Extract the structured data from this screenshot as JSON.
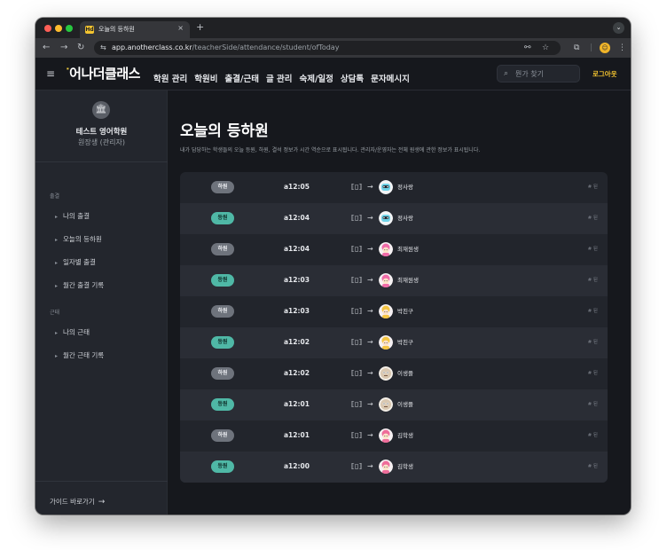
{
  "browser": {
    "tab_title": "오늘의 등하원",
    "favicon_text": "Hd",
    "tab_close": "×",
    "new_tab": "+",
    "tab_menu": "⌄",
    "back": "←",
    "forward": "→",
    "reload": "↻",
    "site_icon": "⇆",
    "url_host": "app.anotherclass.co.kr",
    "url_path": "/teacherSide/attendance/student/ofToday",
    "icons": [
      "link-icon",
      "star-icon",
      "extensions-icon",
      "profile-icon",
      "menu-icon"
    ]
  },
  "header": {
    "hamburger": "≡",
    "logo_spark": "ᴗ̀",
    "logo_text": "어나더클래스",
    "menu": [
      "학원 관리",
      "학원비",
      "출결/근태",
      "글 관리",
      "숙제/일정",
      "상담톡",
      "문자메시지"
    ],
    "search_placeholder": "뭔가 찾기",
    "logout": "로그아웃"
  },
  "sidebar": {
    "school_name": "테스트 영어학원",
    "school_role": "원장생 (관리자)",
    "sections": [
      {
        "title": "출결",
        "items": [
          "나의 출결",
          "오늘의 등하원",
          "일자별 출결",
          "월간 출결 기록"
        ]
      },
      {
        "title": "근태",
        "items": [
          "나의 근태",
          "월간 근태 기록"
        ]
      }
    ],
    "guide": "가이드 바로가기"
  },
  "main": {
    "title": "오늘의 등하원",
    "description": "내가 담당하는 학생들의 오늘 등원, 하원, 결석 정보가 시간 역순으로 표시됩니다. 관리자/운영자는 전체 원생에 관한 정보가 표시됩니다.",
    "arrow": "→",
    "device_icon": "⟦▯⟧",
    "rows": [
      {
        "status": "하원",
        "kind": "out",
        "time": "a12:05",
        "student": "정사랑",
        "avatar": "robot",
        "tag": "# 된"
      },
      {
        "status": "등원",
        "kind": "in",
        "time": "a12:04",
        "student": "정사랑",
        "avatar": "robot",
        "tag": "# 된"
      },
      {
        "status": "하원",
        "kind": "out",
        "time": "a12:04",
        "student": "최재원생",
        "avatar": "pink",
        "tag": "# 된"
      },
      {
        "status": "등원",
        "kind": "in",
        "time": "a12:03",
        "student": "최재원생",
        "avatar": "pink",
        "tag": "# 된"
      },
      {
        "status": "하원",
        "kind": "out",
        "time": "a12:03",
        "student": "박친구",
        "avatar": "yellow",
        "tag": "# 된"
      },
      {
        "status": "등원",
        "kind": "in",
        "time": "a12:02",
        "student": "박친구",
        "avatar": "yellow",
        "tag": "# 된"
      },
      {
        "status": "하원",
        "kind": "out",
        "time": "a12:02",
        "student": "이생플",
        "avatar": "beige",
        "tag": "# 된"
      },
      {
        "status": "등원",
        "kind": "in",
        "time": "a12:01",
        "student": "이생플",
        "avatar": "beige",
        "tag": "# 된"
      },
      {
        "status": "하원",
        "kind": "out",
        "time": "a12:01",
        "student": "김학생",
        "avatar": "rose",
        "tag": "# 된"
      },
      {
        "status": "등원",
        "kind": "in",
        "time": "a12:00",
        "student": "김학생",
        "avatar": "rose",
        "tag": "# 된"
      }
    ]
  },
  "colors": {
    "accent": "#f4c430",
    "badge_in": "#4fb8a6",
    "badge_out": "#6e737c",
    "avatar_robot": "#6fd3e8",
    "avatar_pink": "#f06ba8",
    "avatar_yellow": "#f5c542",
    "avatar_beige": "#d9c7b0",
    "avatar_rose": "#ee6c9a"
  }
}
